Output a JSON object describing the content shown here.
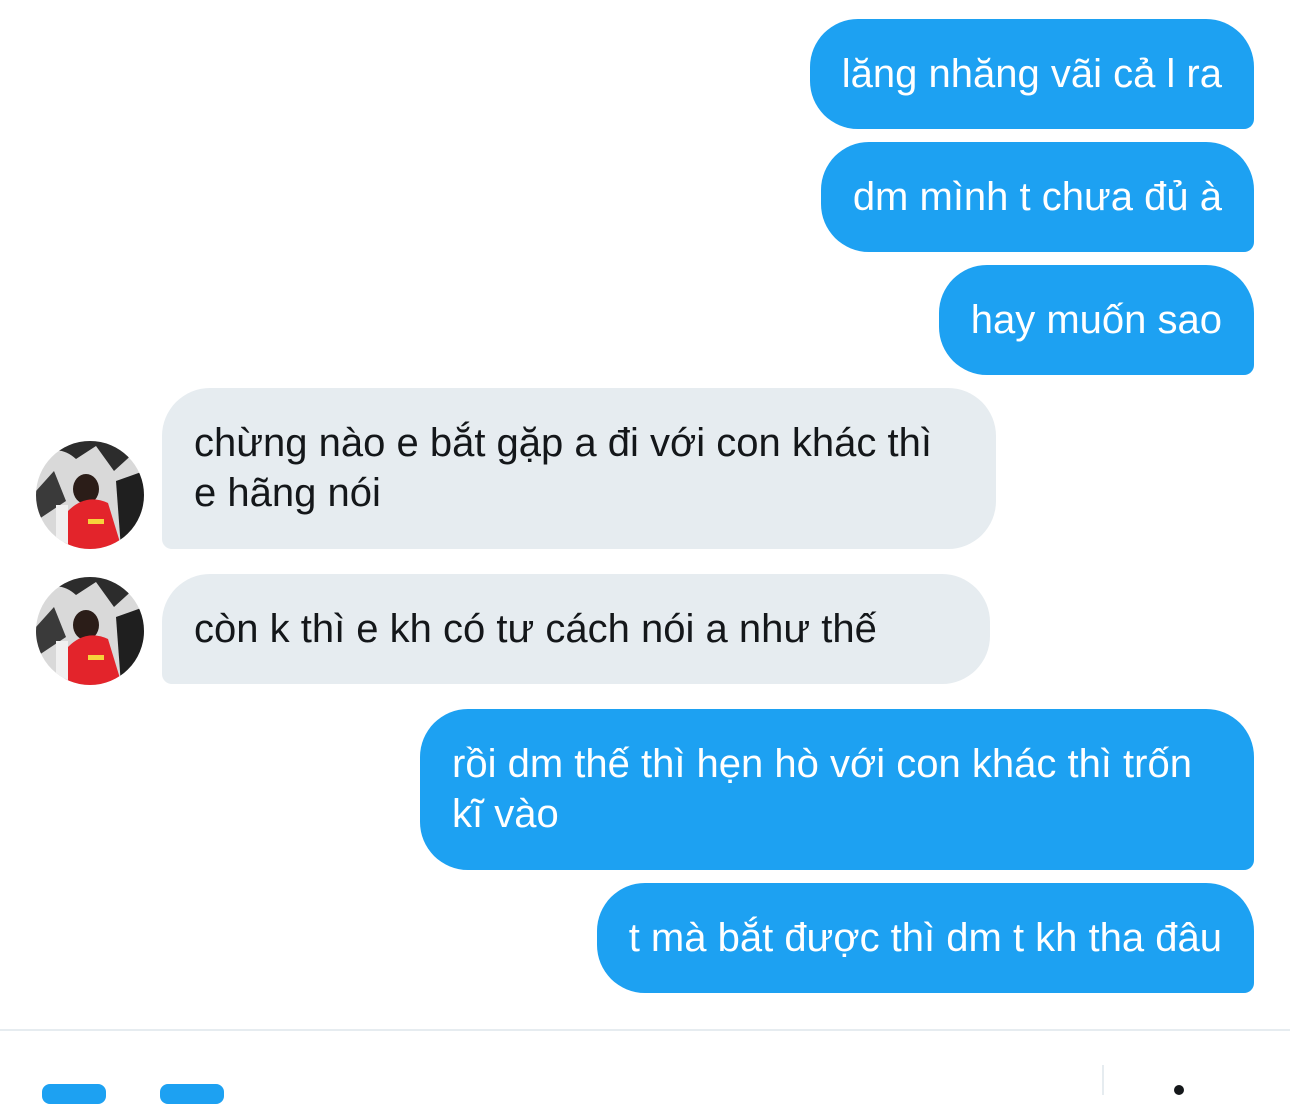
{
  "conversation": {
    "messages": [
      {
        "direction": "sent",
        "text": "lăng nhăng vãi cả l ra"
      },
      {
        "direction": "sent",
        "text": "dm mình t chưa đủ à"
      },
      {
        "direction": "sent",
        "text": "hay muốn sao"
      },
      {
        "direction": "received",
        "text": "chừng nào e bắt gặp a đi với con khác thì e hãng nói"
      },
      {
        "direction": "received",
        "text": "còn k thì e kh có tư cách nói a như thế"
      },
      {
        "direction": "sent",
        "text": "rồi dm thế thì hẹn hò với con khác thì trốn kĩ vào"
      },
      {
        "direction": "sent",
        "text": "t mà bắt được thì dm t kh tha đâu"
      }
    ]
  },
  "colors": {
    "sent_bubble": "#1da1f2",
    "received_bubble": "#e6ecf0",
    "received_text": "#14171a",
    "sent_text": "#ffffff"
  },
  "icons": {
    "avatar": "profile-photo-red-jacket",
    "media": "media-icon",
    "gif": "gif-icon",
    "send": "send-icon"
  }
}
